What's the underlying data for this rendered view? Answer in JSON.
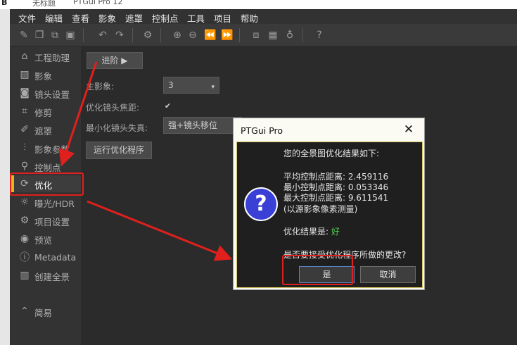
{
  "window": {
    "title_left": "B",
    "title_partial": "无标题",
    "app_partial": "PTGui Pro 12"
  },
  "menu": [
    "文件",
    "编辑",
    "查看",
    "影象",
    "遮罩",
    "控制点",
    "工具",
    "项目",
    "帮助"
  ],
  "toolbar": {
    "icons": [
      "edit-icon",
      "bookmark-icon",
      "copy-icon",
      "save-icon",
      "undo-icon",
      "redo-icon",
      "settings-icon",
      "zoom-in-icon",
      "zoom-out-icon",
      "rewind-icon",
      "fast-forward-icon",
      "panorama-icon",
      "grid-icon",
      "bulb-icon",
      "help-icon"
    ]
  },
  "sidebar": {
    "items": [
      {
        "label": "工程助理",
        "icon": "home-icon"
      },
      {
        "label": "影象",
        "icon": "image-icon"
      },
      {
        "label": "镜头设置",
        "icon": "camera-icon"
      },
      {
        "label": "修剪",
        "icon": "crop-icon"
      },
      {
        "label": "遮罩",
        "icon": "mask-icon"
      },
      {
        "label": "影象参数",
        "icon": "sliders-icon"
      },
      {
        "label": "控制点",
        "icon": "control-points-icon"
      },
      {
        "label": "优化",
        "icon": "optimize-icon"
      },
      {
        "label": "曝光/HDR",
        "icon": "sun-icon"
      },
      {
        "label": "项目设置",
        "icon": "gear-icon"
      },
      {
        "label": "预览",
        "icon": "eye-icon"
      },
      {
        "label": "Metadata",
        "icon": "info-icon"
      },
      {
        "label": "创建全景",
        "icon": "panorama-create-icon"
      }
    ],
    "simple_label": "简易",
    "active_index": 7
  },
  "main": {
    "advanced_button": "进阶 ▶",
    "anchor_label": "主影象:",
    "anchor_value": "3",
    "optimize_lens_label": "优化镜头焦距:",
    "optimize_lens_checked": true,
    "minimize_distortion_label": "最小化镜头失真:",
    "minimize_distortion_value": "强+镜头移位",
    "run_button": "运行优化程序"
  },
  "dialog": {
    "title": "PTGui Pro",
    "close": "✕",
    "heading": "您的全景图优化结果如下:",
    "avg_line": "平均控制点距离: 2.459116",
    "min_line": "最小控制点距离: 0.053346",
    "max_line": "最大控制点距离: 9.611541",
    "unit_note": "(以源影象像素测量)",
    "result_label": "优化结果是:",
    "result_value": "好",
    "question": "是否要接受优化程序所做的更改?",
    "yes": "是",
    "cancel": "取消"
  },
  "colors": {
    "annotation_red": "#e0201c",
    "active_bar": "#e8b417",
    "good_green": "#4fd34f",
    "question_icon": "#3a3fd6"
  }
}
